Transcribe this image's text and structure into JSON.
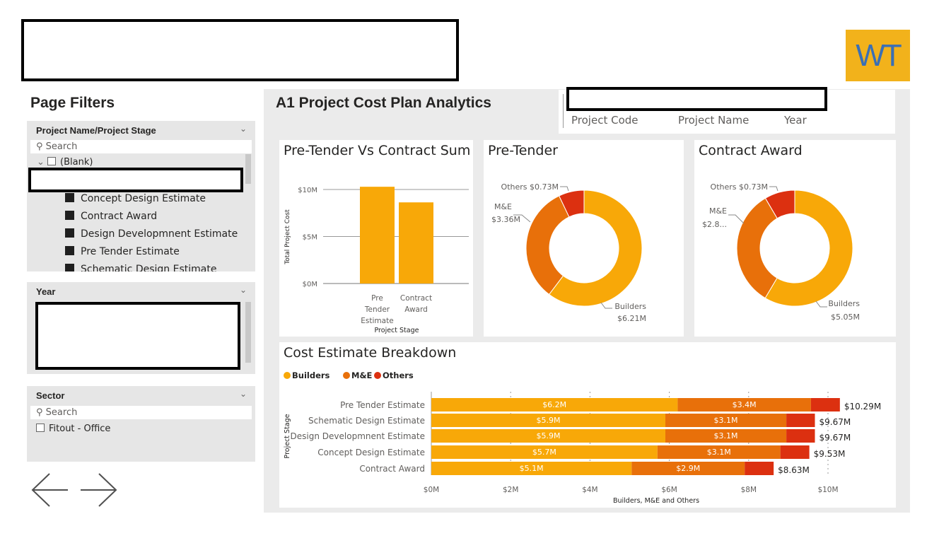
{
  "logo": {
    "text": "WT"
  },
  "filters": {
    "title": "Page Filters",
    "project_slicer": {
      "header": "Project Name/Project Stage",
      "search_placeholder": "Search",
      "blank_label": "(Blank)",
      "stages": [
        "Concept Design Estimate",
        "Contract Award",
        "Design Developmnent Estimate",
        "Pre Tender Estimate",
        "Schematic Design Estimate"
      ]
    },
    "year_slicer": {
      "header": "Year"
    },
    "sector_slicer": {
      "header": "Sector",
      "search_placeholder": "Search",
      "items": [
        "Fitout - Office"
      ]
    }
  },
  "main": {
    "title": "A1 Project Cost Plan Analytics",
    "project_header": {
      "code_label": "Project Code",
      "name_label": "Project Name",
      "year_label": "Year"
    }
  },
  "colors": {
    "builders": "#F8A808",
    "me": "#E8700A",
    "others": "#DC3010",
    "logo_bg": "#F2B21B",
    "logo_text": "#3A6FB5"
  },
  "chart_data": [
    {
      "type": "bar",
      "title": "Pre-Tender Vs Contract Sum",
      "categories": [
        "Pre Tender Estimate",
        "Contract Award"
      ],
      "values": [
        10.29,
        8.63
      ],
      "xlabel": "Project Stage",
      "ylabel": "Total Project Cost",
      "ylim": [
        0,
        10
      ],
      "tick_labels": [
        "$0M",
        "$5M",
        "$10M"
      ],
      "grid": true
    },
    {
      "type": "pie",
      "title": "Pre-Tender",
      "labels": [
        "Builders",
        "M&E",
        "Others"
      ],
      "values": [
        6.21,
        3.36,
        0.73
      ],
      "value_labels": [
        "$6.21M",
        "$3.36M",
        "$0.73M"
      ]
    },
    {
      "type": "pie",
      "title": "Contract Award",
      "labels": [
        "Builders",
        "M&E",
        "Others"
      ],
      "values": [
        5.05,
        2.85,
        0.73
      ],
      "value_labels": [
        "$5.05M",
        "$2.8...",
        "$0.73M"
      ]
    },
    {
      "type": "bar",
      "orientation": "horizontal",
      "stacked": true,
      "title": "Cost Estimate Breakdown",
      "legend": [
        "Builders",
        "M&E",
        "Others"
      ],
      "legend_position": "top-left",
      "categories": [
        "Pre Tender Estimate",
        "Schematic Design Estimate",
        "Design Developmnent Estimate",
        "Concept Design Estimate",
        "Contract Award"
      ],
      "series": [
        {
          "name": "Builders",
          "values": [
            6.21,
            5.9,
            5.9,
            5.7,
            5.05
          ],
          "labels": [
            "$6.2M",
            "$5.9M",
            "$5.9M",
            "$5.7M",
            "$5.1M"
          ]
        },
        {
          "name": "M&E",
          "values": [
            3.36,
            3.05,
            3.05,
            3.1,
            2.85
          ],
          "labels": [
            "$3.4M",
            "$3.1M",
            "$3.1M",
            "$3.1M",
            "$2.9M"
          ]
        },
        {
          "name": "Others",
          "values": [
            0.73,
            0.72,
            0.72,
            0.73,
            0.73
          ]
        }
      ],
      "totals": [
        "$10.29M",
        "$9.67M",
        "$9.67M",
        "$9.53M",
        "$8.63M"
      ],
      "xlabel": "Builders, M&E and Others",
      "ylabel": "Project Stage",
      "xlim": [
        0,
        10
      ],
      "tick_labels": [
        "$0M",
        "$2M",
        "$4M",
        "$6M",
        "$8M",
        "$10M"
      ]
    }
  ]
}
